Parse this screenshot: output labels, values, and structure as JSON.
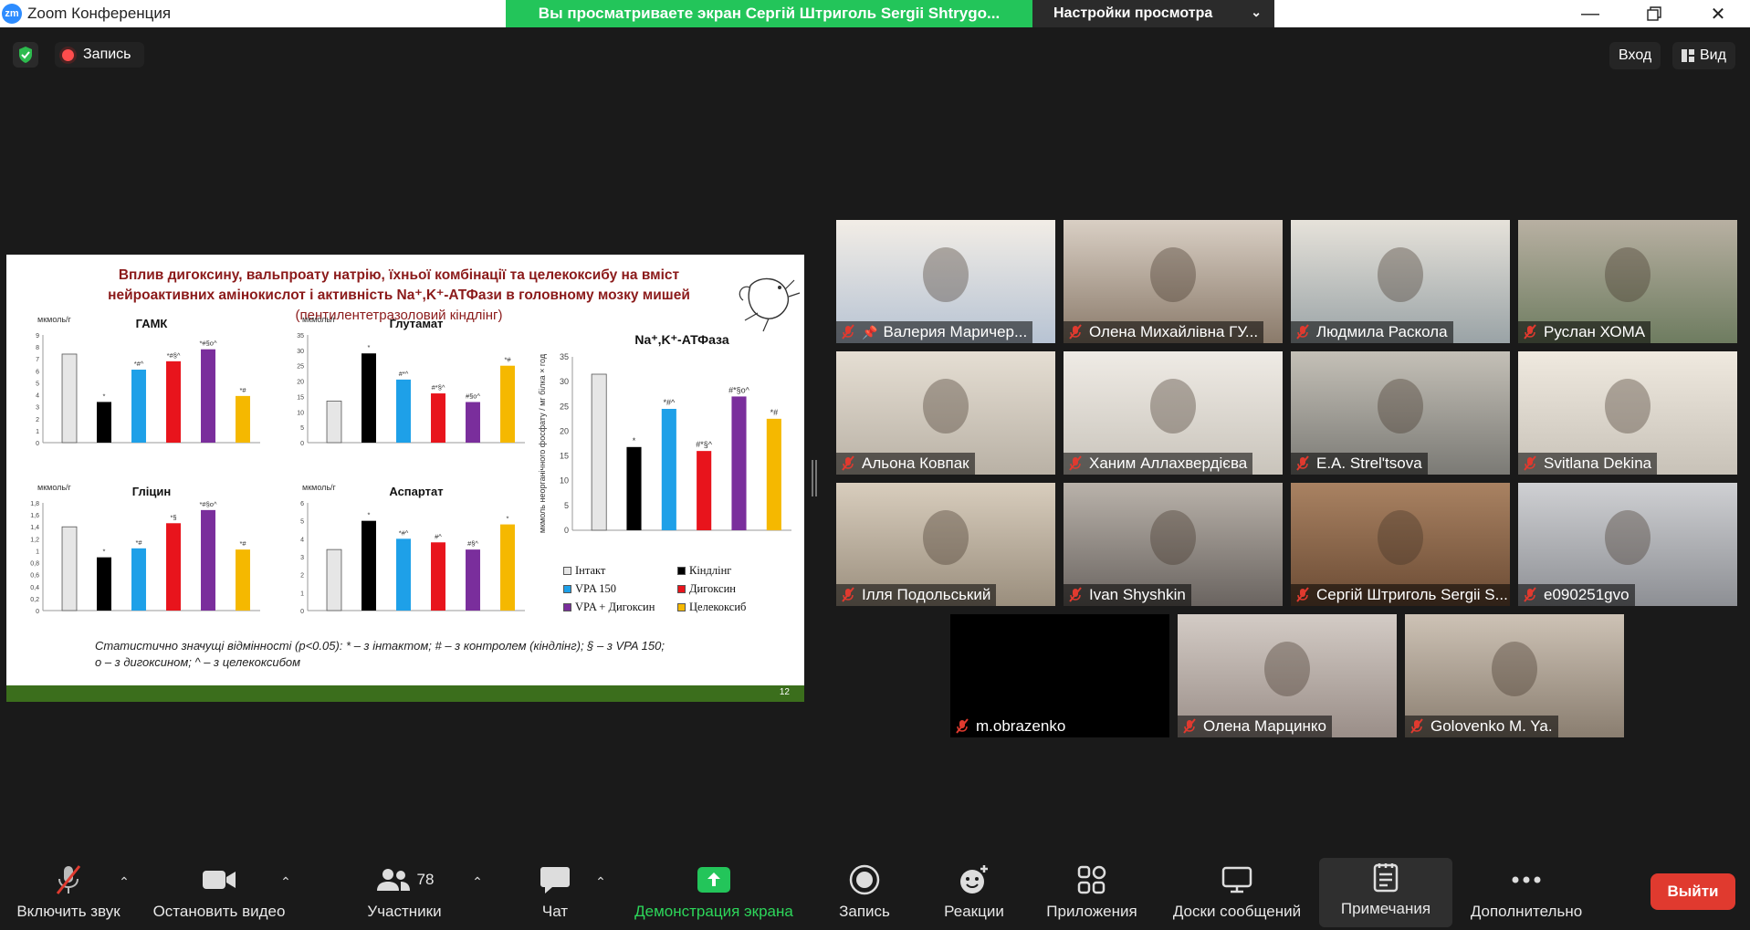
{
  "window": {
    "logo": "zm",
    "title": "Zoom Конференция",
    "share_banner": "Вы просматриваете экран Сергій Штриголь Sergii Shtrygo...",
    "view_settings": "Настройки просмотра"
  },
  "topbar": {
    "record_label": "Запись",
    "enter_label": "Вход",
    "view_label": "Вид"
  },
  "slide": {
    "title_line1": "Вплив дигоксину, вальпроату натрію, їхньої комбінації та целекоксибу на вміст",
    "title_line2": "нейроактивних амінокислот і активність Na⁺,K⁺-АТФази в головному мозку мишей",
    "subtitle": "(пентилентетразоловий кіндлінг)",
    "stats_note_line1": "Статистично значущі відмінності (p<0.05): * – з інтактом; # – з контролем (кіндлінг); § – з VPA 150;",
    "stats_note_line2": "о – з дигоксином; ^ – з целекоксибом",
    "slide_number": "12",
    "colors": [
      "#e6e6e6",
      "#000000",
      "#1ea0e8",
      "#e8141c",
      "#7a2e9c",
      "#f5b800"
    ],
    "legend": [
      {
        "label": "Інтакт",
        "color": "#e6e6e6"
      },
      {
        "label": "Кіндлінг",
        "color": "#000000"
      },
      {
        "label": "VPA 150",
        "color": "#1ea0e8"
      },
      {
        "label": "Дигоксин",
        "color": "#e8141c"
      },
      {
        "label": "VPA + Дигоксин",
        "color": "#7a2e9c"
      },
      {
        "label": "Целекоксиб",
        "color": "#f5b800"
      }
    ]
  },
  "chart_data": [
    {
      "type": "bar",
      "title": "ГАМК",
      "ylabel": "мкмоль/г",
      "ylim": [
        0,
        9
      ],
      "ticks": [
        "0",
        "1",
        "2",
        "3",
        "4",
        "5",
        "6",
        "7",
        "8",
        "9"
      ],
      "values": [
        7.4,
        3.4,
        6.1,
        6.8,
        7.8,
        3.9
      ],
      "annotations": [
        "",
        "*",
        "*#^",
        "*#§^",
        "*#§o^",
        "*#"
      ]
    },
    {
      "type": "bar",
      "title": "Глутамат",
      "ylabel": "мкмоль/г",
      "ylim": [
        0,
        35
      ],
      "ticks": [
        "0",
        "5",
        "10",
        "15",
        "20",
        "25",
        "30",
        "35"
      ],
      "values": [
        13.5,
        29,
        20.5,
        16,
        13.2,
        25
      ],
      "annotations": [
        "",
        "*",
        "#*^",
        "#*§^",
        "#§o^",
        "*#"
      ]
    },
    {
      "type": "bar",
      "title": "Гліцин",
      "ylabel": "мкмоль/г",
      "ylim": [
        0,
        1.8
      ],
      "ticks": [
        "0",
        "0,2",
        "0,4",
        "0,6",
        "0,8",
        "1",
        "1,2",
        "1,4",
        "1,6",
        "1,8"
      ],
      "values": [
        1.4,
        0.89,
        1.04,
        1.46,
        1.68,
        1.02
      ],
      "annotations": [
        "",
        "*",
        "*#",
        "*§",
        "*#§o^",
        "*#"
      ]
    },
    {
      "type": "bar",
      "title": "Аспартат",
      "ylabel": "мкмоль/г",
      "ylim": [
        0,
        6
      ],
      "ticks": [
        "0",
        "1",
        "2",
        "3",
        "4",
        "5",
        "6"
      ],
      "values": [
        3.4,
        5.0,
        4.0,
        3.8,
        3.4,
        4.8
      ],
      "annotations": [
        "",
        "*",
        "*#^",
        "#^",
        "#§^",
        "*"
      ]
    },
    {
      "type": "bar",
      "title": "Na⁺,K⁺-АТФаза",
      "ylabel": "мкмоль неорганічного фосфату / мг білка × год",
      "ylim": [
        0,
        35
      ],
      "ticks": [
        "0",
        "5",
        "10",
        "15",
        "20",
        "25",
        "30",
        "35"
      ],
      "values": [
        31.5,
        16.8,
        24.5,
        16,
        27,
        22.5
      ],
      "annotations": [
        "",
        "*",
        "*#^",
        "#*§^",
        "#*§o^",
        "*#"
      ]
    }
  ],
  "participants": [
    {
      "name": "Валерия Маричер...",
      "pinned": true
    },
    {
      "name": "Олена Михайлівна ГУ..."
    },
    {
      "name": "Людмила Раскола"
    },
    {
      "name": "Руслан ХОМА"
    },
    {
      "name": "Альона Ковпак"
    },
    {
      "name": "Ханим Аллахвердієва"
    },
    {
      "name": "E.A. Strel'tsova"
    },
    {
      "name": "Svitlana Dekina"
    },
    {
      "name": "Ілля Подольський"
    },
    {
      "name": "Ivan Shyshkin"
    },
    {
      "name": "Сергій Штриголь Sergii S..."
    },
    {
      "name": "e090251gvo"
    },
    {
      "name": "m.obrazenko"
    },
    {
      "name": "Олена Марцинко"
    },
    {
      "name": "Golovenko M. Ya."
    }
  ],
  "toolbar": {
    "unmute": "Включить звук",
    "stop_video": "Остановить видео",
    "participants": "Участники",
    "participants_count": "78",
    "chat": "Чат",
    "share_screen": "Демонстрация экрана",
    "record": "Запись",
    "reactions": "Реакции",
    "apps": "Приложения",
    "whiteboards": "Доски сообщений",
    "notes": "Примечания",
    "more": "Дополнительно",
    "leave": "Выйти"
  }
}
